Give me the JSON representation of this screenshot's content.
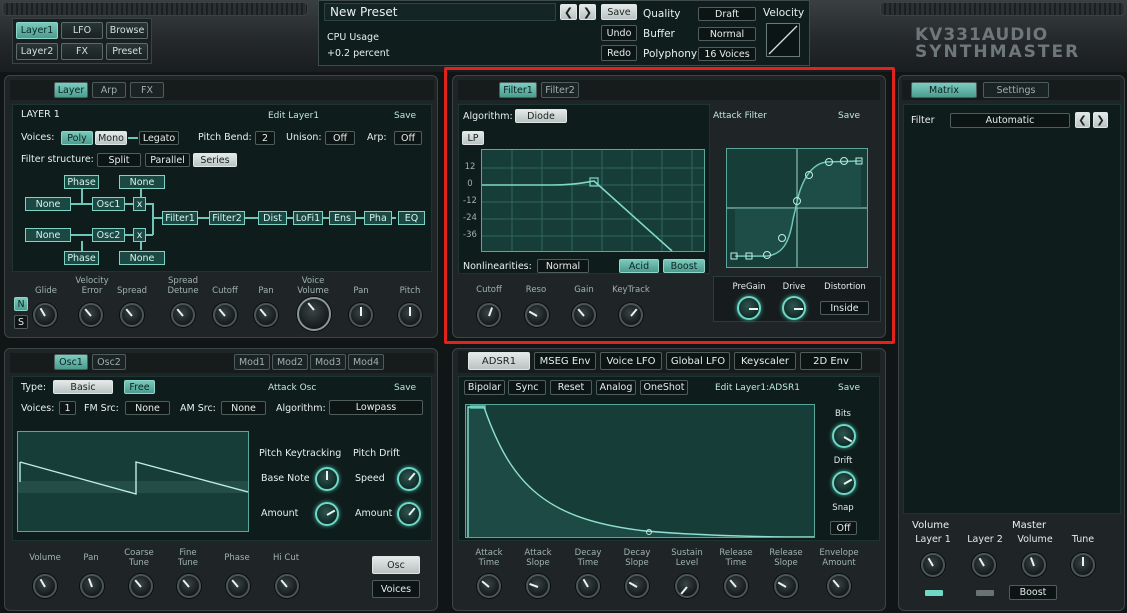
{
  "top": {
    "layer_tabs": [
      "Layer1",
      "LFO",
      "Browse",
      "Layer2",
      "FX",
      "Preset"
    ],
    "preset_name": "New Preset",
    "save": "Save",
    "undo": "Undo",
    "redo": "Redo",
    "cpu_label": "CPU Usage",
    "cpu_value": "+0.2 percent",
    "quality_label": "Quality",
    "quality_value": "Draft",
    "buffer_label": "Buffer",
    "buffer_value": "Normal",
    "polyphony_label": "Polyphony",
    "polyphony_value": "16 Voices",
    "velocity_label": "Velocity",
    "brand_line1": "KV331AUDIO",
    "brand_line2": "SYNTHMASTER"
  },
  "layer": {
    "tabs": [
      "Layer",
      "Arp",
      "FX"
    ],
    "title": "LAYER 1",
    "edit": "Edit Layer1",
    "save": "Save",
    "voices_label": "Voices:",
    "poly": "Poly",
    "mono": "Mono",
    "legato": "Legato",
    "pitch_bend_label": "Pitch Bend:",
    "pitch_bend_value": "2",
    "unison_label": "Unison:",
    "unison_value": "Off",
    "arp_label": "Arp:",
    "arp_value": "Off",
    "filter_structure_label": "Filter structure:",
    "split": "Split",
    "parallel": "Parallel",
    "series": "Series",
    "routing": {
      "phase1": "Phase",
      "none1": "None",
      "none_left1": "None",
      "osc1": "Osc1",
      "x1": "x",
      "none_left2": "None",
      "osc2": "Osc2",
      "x2": "x",
      "phase2": "Phase",
      "none2": "None",
      "chain": [
        "Filter1",
        "Filter2",
        "Dist",
        "LoFi1",
        "Ens",
        "Pha",
        "EQ"
      ]
    },
    "knobs": [
      {
        "top": "",
        "label": "Glide"
      },
      {
        "top": "Velocity",
        "label": "Error"
      },
      {
        "top": "",
        "label": "Spread"
      },
      {
        "top": "Spread",
        "label": "Detune"
      },
      {
        "top": "",
        "label": "Cutoff"
      },
      {
        "top": "",
        "label": "Pan"
      },
      {
        "top": "Voice",
        "label": "Volume"
      },
      {
        "top": "",
        "label": "Pan"
      },
      {
        "top": "",
        "label": "Pitch"
      }
    ],
    "n": "N",
    "s": "S"
  },
  "filter": {
    "tabs": [
      "Filter1",
      "Filter2"
    ],
    "algorithm_label": "Algorithm:",
    "algorithm_value": "Diode",
    "attack_filter": "Attack Filter",
    "save": "Save",
    "mode": "LP",
    "y_ticks": [
      "12",
      "0",
      "-12",
      "-24",
      "-36"
    ],
    "nonlinearities_label": "Nonlinearities:",
    "nonlinearities_value": "Normal",
    "acid": "Acid",
    "boost": "Boost",
    "knobs": [
      "Cutoff",
      "Reso",
      "Gain",
      "KeyTrack"
    ],
    "pregain": "PreGain",
    "drive": "Drive",
    "distortion": "Distortion",
    "inside": "Inside"
  },
  "matrix": {
    "tabs": [
      "Matrix",
      "Settings"
    ],
    "filter_label": "Filter",
    "filter_value": "Automatic",
    "volume": "Volume",
    "master": "Master",
    "labels": [
      "Layer 1",
      "Layer 2",
      "Volume",
      "Tune"
    ],
    "boost": "Boost"
  },
  "osc": {
    "tabs": [
      "Osc1",
      "Osc2"
    ],
    "mod_tabs": [
      "Mod1",
      "Mod2",
      "Mod3",
      "Mod4"
    ],
    "type_label": "Type:",
    "type_value": "Basic",
    "free": "Free",
    "attack_osc": "Attack Osc",
    "save": "Save",
    "voices_label": "Voices:",
    "voices_value": "1",
    "fm_label": "FM Src:",
    "fm_value": "None",
    "am_label": "AM Src:",
    "am_value": "None",
    "algorithm_label": "Algorithm:",
    "algorithm_value": "Lowpass",
    "pitch_keytracking": "Pitch Keytracking",
    "pitch_drift": "Pitch Drift",
    "base_note": "Base Note",
    "speed": "Speed",
    "amount1": "Amount",
    "amount2": "Amount",
    "knobs": [
      {
        "top": "",
        "label": "Volume"
      },
      {
        "top": "",
        "label": "Pan"
      },
      {
        "top": "Coarse",
        "label": "Tune"
      },
      {
        "top": "Fine",
        "label": "Tune"
      },
      {
        "top": "",
        "label": "Phase"
      },
      {
        "top": "",
        "label": "Hi Cut"
      }
    ],
    "osc_btn": "Osc",
    "voices_btn": "Voices"
  },
  "env": {
    "tabs": [
      "ADSR1",
      "MSEG Env",
      "Voice LFO",
      "Global LFO",
      "Keyscaler",
      "2D Env"
    ],
    "buttons": [
      "Bipolar",
      "Sync",
      "Reset",
      "Analog",
      "OneShot"
    ],
    "edit": "Edit Layer1:ADSR1",
    "save": "Save",
    "bits": "Bits",
    "drift": "Drift",
    "snap": "Snap",
    "snap_value": "Off",
    "knobs": [
      {
        "top": "Attack",
        "label": "Time"
      },
      {
        "top": "Attack",
        "label": "Slope"
      },
      {
        "top": "Decay",
        "label": "Time"
      },
      {
        "top": "Decay",
        "label": "Slope"
      },
      {
        "top": "Sustain",
        "label": "Level"
      },
      {
        "top": "Release",
        "label": "Time"
      },
      {
        "top": "Release",
        "label": "Slope"
      },
      {
        "top": "Envelope",
        "label": "Amount"
      }
    ]
  },
  "colors": {
    "accent": "#6fd8c6",
    "highlight": "#e0231c"
  }
}
